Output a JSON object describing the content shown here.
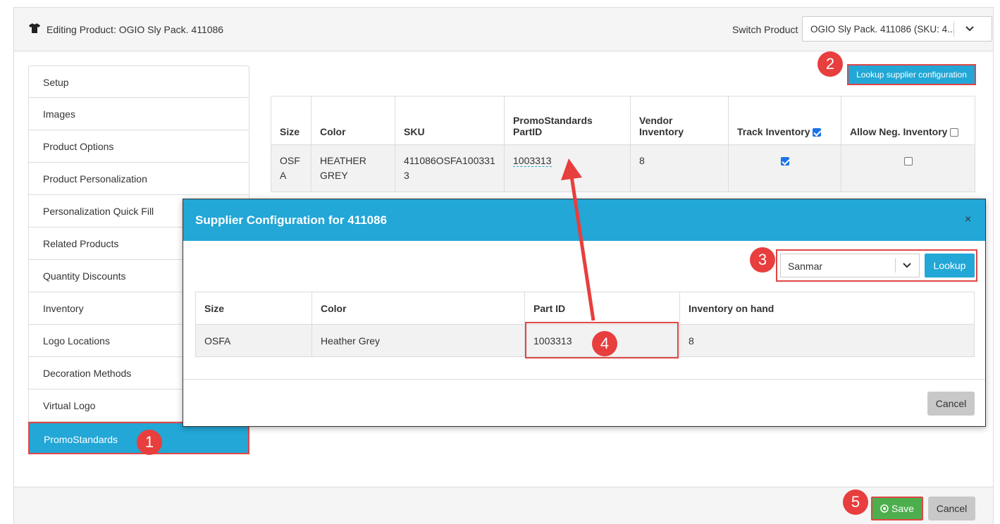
{
  "header": {
    "title": "Editing Product: OGIO Sly Pack. 411086",
    "switch_label": "Switch Product",
    "switch_value": "OGIO Sly Pack. 411086 (SKU: 4..."
  },
  "sidebar": {
    "items": [
      {
        "label": "Setup"
      },
      {
        "label": "Images"
      },
      {
        "label": "Product Options"
      },
      {
        "label": "Product Personalization"
      },
      {
        "label": "Personalization Quick Fill"
      },
      {
        "label": "Related Products"
      },
      {
        "label": "Quantity Discounts"
      },
      {
        "label": "Inventory"
      },
      {
        "label": "Logo Locations"
      },
      {
        "label": "Decoration Methods"
      },
      {
        "label": "Virtual Logo"
      },
      {
        "label": "PromoStandards"
      }
    ]
  },
  "lookup_button": "Lookup supplier configuration",
  "table": {
    "headers": {
      "size": "Size",
      "color": "Color",
      "sku": "SKU",
      "partid_1": "PromoStandards",
      "partid_2": "PartID",
      "vendor_1": "Vendor",
      "vendor_2": "Inventory",
      "track": "Track Inventory",
      "allow": "Allow Neg. Inventory"
    },
    "row": {
      "size_1": "OSF",
      "size_2": "A",
      "color_1": "HEATHER",
      "color_2": "GREY",
      "sku_1": "411086OSFA100331",
      "sku_2": "3",
      "partid": "1003313",
      "vendor_inventory": "8"
    }
  },
  "modal": {
    "title": "Supplier Configuration for 411086",
    "close": "×",
    "vendor_value": "Sanmar",
    "lookup": "Lookup",
    "headers": {
      "size": "Size",
      "color": "Color",
      "partid": "Part ID",
      "inventory": "Inventory on hand"
    },
    "row": {
      "size": "OSFA",
      "color": "Heather Grey",
      "partid": "1003313",
      "inventory": "8"
    },
    "cancel": "Cancel"
  },
  "footer": {
    "save": "Save",
    "cancel": "Cancel"
  },
  "badges": {
    "b1": "1",
    "b2": "2",
    "b3": "3",
    "b4": "4",
    "b5": "5"
  },
  "colors": {
    "accent": "#22a7d6",
    "highlight": "#e04646",
    "badge": "#e83e3e",
    "save": "#4cae4c"
  }
}
